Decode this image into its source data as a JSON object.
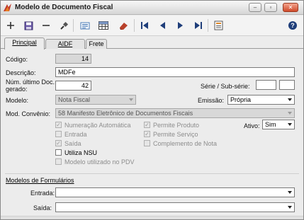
{
  "window": {
    "title": "Modelo de Documento Fiscal"
  },
  "tabs": [
    {
      "label": "Principal"
    },
    {
      "label": "AIDF"
    },
    {
      "label": "Frete"
    }
  ],
  "form": {
    "codigo": {
      "label": "Código:",
      "value": "14"
    },
    "descricao": {
      "label": "Descrição:",
      "value": "MDFe"
    },
    "num_ultimo": {
      "label_line1": "Núm. último Doc.",
      "label_line2": "gerado:",
      "value": "42"
    },
    "serie": {
      "label": "Série / Sub-série:",
      "serie_value": "",
      "subserie_value": ""
    },
    "modelo": {
      "label": "Modelo:",
      "value": "Nota Fiscal"
    },
    "emissao": {
      "label": "Emissão:",
      "value": "Própria"
    },
    "mod_convenio": {
      "label": "Mod. Convênio:",
      "value": "58 Manifesto Eletrônico de Documentos Fiscais"
    },
    "ativo": {
      "label": "Ativo:",
      "value": "Sim"
    }
  },
  "checkboxes": {
    "numeracao_automatica": {
      "label": "Numeração Automática",
      "checked": true,
      "enabled": false
    },
    "entrada": {
      "label": "Entrada",
      "checked": false,
      "enabled": false
    },
    "saida": {
      "label": "Saída",
      "checked": true,
      "enabled": false
    },
    "utiliza_nsu": {
      "label": "Utiliza NSU",
      "checked": false,
      "enabled": true
    },
    "modelo_pdv": {
      "label": "Modelo utilizado no PDV",
      "checked": false,
      "enabled": false
    },
    "permite_produto": {
      "label": "Permite Produto",
      "checked": true,
      "enabled": false
    },
    "permite_servico": {
      "label": "Permite Serviço",
      "checked": true,
      "enabled": false
    },
    "complemento_nota": {
      "label": "Complemento de Nota",
      "checked": false,
      "enabled": false
    }
  },
  "formularios": {
    "title": "Modelos de Formulários",
    "entrada": {
      "label": "Entrada:",
      "value": ""
    },
    "saida": {
      "label": "Saída:",
      "value": ""
    }
  },
  "toolbar": {
    "icons": [
      "add-icon",
      "save-icon",
      "remove-icon",
      "search-icon",
      "print-preview-icon",
      "grid-icon",
      "eraser-icon",
      "first-record-icon",
      "previous-record-icon",
      "next-record-icon",
      "last-record-icon",
      "report-icon",
      "help-icon"
    ]
  },
  "colors": {
    "accent": "#1f5ea8",
    "window_bg": "#ececec",
    "readonly_bg": "#d8d8d8"
  }
}
